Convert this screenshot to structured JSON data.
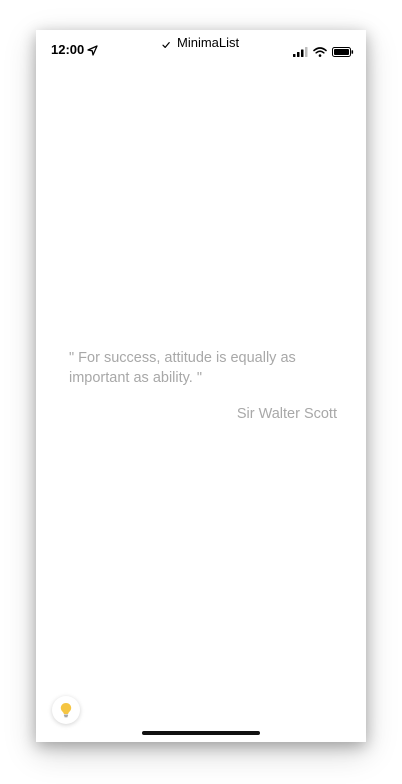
{
  "status_bar": {
    "time": "12:00",
    "app_name": "MinimaList",
    "icons": [
      "location-arrow-icon",
      "check-icon",
      "cellular-signal-icon",
      "wifi-icon",
      "battery-icon"
    ]
  },
  "quote": {
    "text": "\" For success, attitude is equally as important as ability. \"",
    "author": "Sir Walter Scott"
  },
  "floating_button": {
    "icon": "lightbulb-icon",
    "icon_color": "#f5c542"
  },
  "colors": {
    "quote_text": "#a8a8a8",
    "background": "#ffffff"
  }
}
